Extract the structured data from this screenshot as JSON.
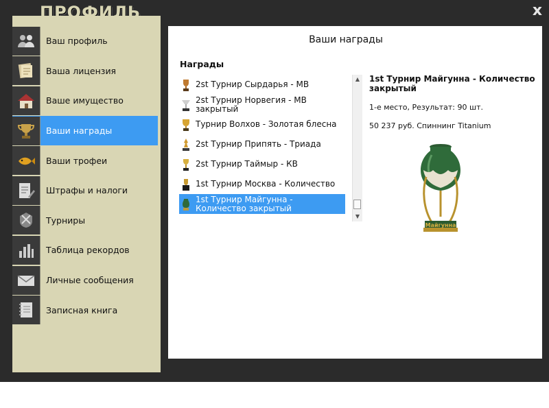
{
  "window": {
    "title": "ПРОФИЛЬ",
    "close_label": "x"
  },
  "sidebar": {
    "items": [
      {
        "label": "Ваш профиль",
        "icon": "users-icon",
        "active": false
      },
      {
        "label": "Ваша лицензия",
        "icon": "license-icon",
        "active": false
      },
      {
        "label": "Ваше имущество",
        "icon": "house-icon",
        "active": false
      },
      {
        "label": "Ваши награды",
        "icon": "cup-icon",
        "active": true
      },
      {
        "label": "Ваши трофеи",
        "icon": "fish-icon",
        "active": false
      },
      {
        "label": "Штрафы и налоги",
        "icon": "document-pen-icon",
        "active": false
      },
      {
        "label": "Турниры",
        "icon": "tournament-icon",
        "active": false
      },
      {
        "label": "Таблица рекордов",
        "icon": "bar-chart-icon",
        "active": false
      },
      {
        "label": "Личные сообщения",
        "icon": "envelope-icon",
        "active": false
      },
      {
        "label": "Записная книга",
        "icon": "notebook-icon",
        "active": false
      }
    ]
  },
  "main": {
    "title": "Ваши награды",
    "section_title": "Награды",
    "awards": [
      {
        "label": "2st Турнир Сырдарья - МВ",
        "icon": "trophy-bronze-icon",
        "selected": false
      },
      {
        "label": "2st Турнир Норвегия - МВ закрытый",
        "icon": "trophy-silver-icon",
        "selected": false
      },
      {
        "label": "Турнир Волхов - Золотая блесна",
        "icon": "trophy-gold-icon",
        "selected": false
      },
      {
        "label": "2st Турнир Припять - Триада",
        "icon": "trophy-figure-icon",
        "selected": false
      },
      {
        "label": "2st Турнир Таймыр - КВ",
        "icon": "trophy-gold-icon",
        "selected": false
      },
      {
        "label": "1st Турнир Москва - Количество",
        "icon": "trophy-dark-icon",
        "selected": false
      },
      {
        "label": "1st Турнир Майгунна - Количество закрытый",
        "icon": "trophy-vase-icon",
        "selected": true
      }
    ],
    "detail": {
      "title": "1st Турнир Майгунна - Количество закрытый",
      "result": "1-е место, Результат: 90 шт.",
      "prize": "50 237 руб. Спиннинг Titanium",
      "trophy_caption": "Майгунна"
    }
  },
  "colors": {
    "frame": "#2b2b2b",
    "sidebar_bg": "#d9d6b4",
    "accent": "#3d9bf2",
    "content_bg": "#ffffff"
  }
}
